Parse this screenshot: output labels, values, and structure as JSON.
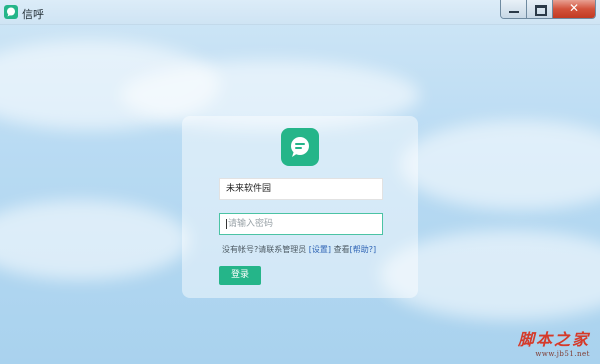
{
  "window": {
    "title": "信呼",
    "close_glyph": "✕"
  },
  "login": {
    "username_value": "未来软件园",
    "password_placeholder": "请输入密码",
    "hint_text": "没有帐号?请联系管理员",
    "settings_link": "[设置]",
    "view_text": "查看",
    "help_link": "[帮助?]",
    "login_button_label": "登录"
  },
  "watermark": {
    "main": "脚本之家",
    "sub": "www.jb51.net"
  },
  "colors": {
    "accent": "#25b589",
    "focus_border": "#4bc3a4",
    "link": "#2f64b5"
  },
  "icons": {
    "app": "chat-bubble-icon",
    "logo": "chat-bubble-icon"
  }
}
